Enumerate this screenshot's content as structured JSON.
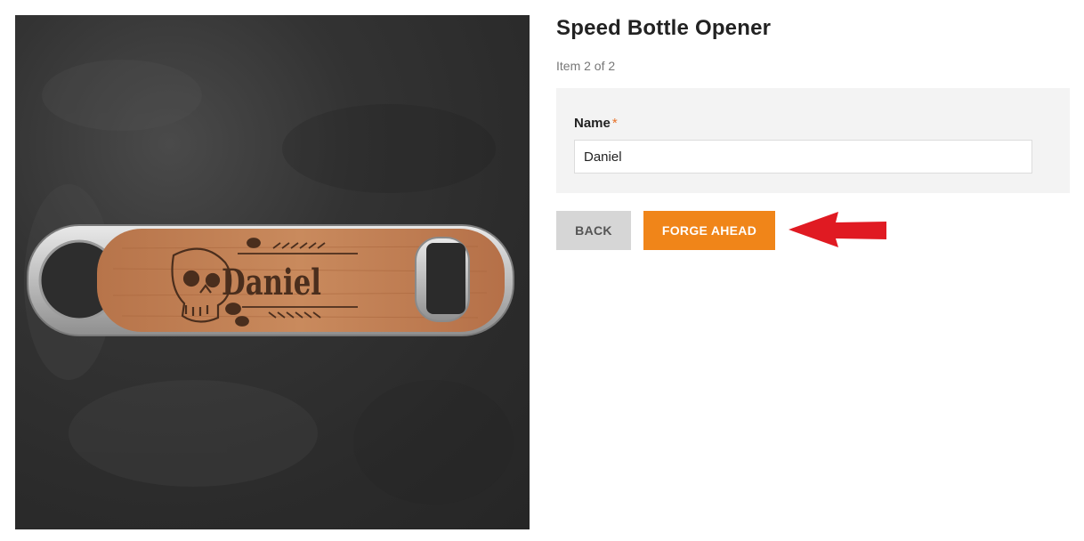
{
  "product": {
    "title": "Speed Bottle Opener",
    "item_position": "Item 2 of 2",
    "engraved_name": "Daniel"
  },
  "form": {
    "name_label": "Name",
    "required_marker": "*",
    "name_value": "Daniel"
  },
  "actions": {
    "back_label": "BACK",
    "forge_label": "FORGE AHEAD"
  },
  "colors": {
    "accent": "#f08519",
    "required": "#e8732a",
    "arrow": "#e01a22"
  }
}
